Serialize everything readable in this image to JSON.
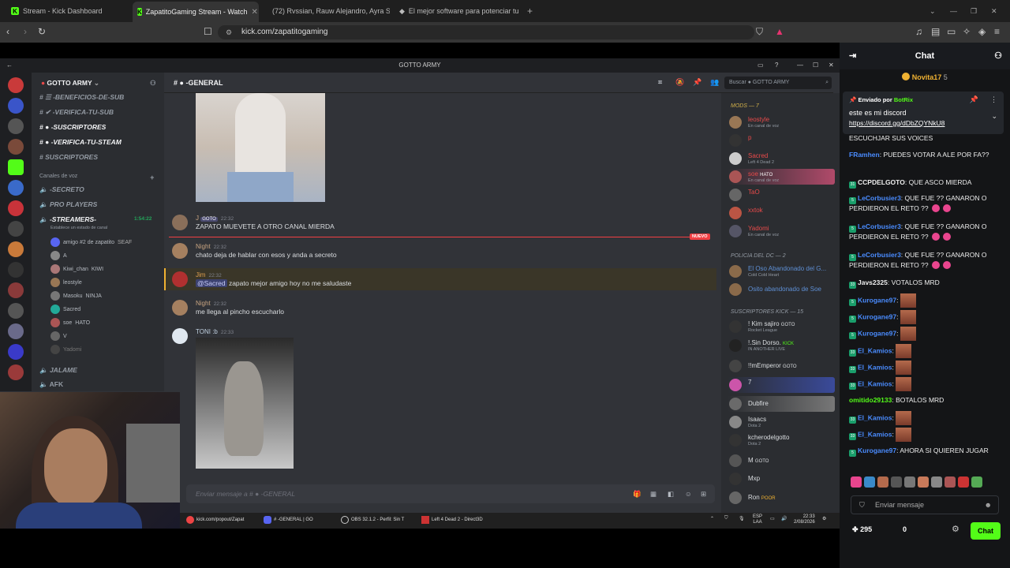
{
  "browser": {
    "tabs": [
      {
        "title": "Stream - Kick Dashboard"
      },
      {
        "title": "ZapatitoGaming Stream - Watch"
      },
      {
        "title": "(72) Rvssian, Rauw Alejandro, Ayra St"
      },
      {
        "title": "El mejor software para potenciar tu st"
      }
    ],
    "url": "kick.com/zapatitogaming"
  },
  "discord": {
    "window_title": "GOTTO ARMY",
    "server_name": "GOTTO ARMY",
    "current_channel": "-GENERAL",
    "search_placeholder": "Buscar",
    "search_scope": "GOTTO ARMY",
    "channels": [
      "-BENEFICIOS-DE-SUB",
      "-VERIFICA-TU-SUB",
      "-SUSCRIPTORES",
      "-VERIFICA-TU-STEAM",
      "SUSCRIPTORES"
    ],
    "voice_header": "Canales de voz",
    "voice_channels": [
      "-SECRETO",
      "PRO PLAYERS",
      "-STREAMERS-"
    ],
    "streamers_timer": "1:54:22",
    "streamers_status": "Establece un estado de canal",
    "voice_users": [
      "amigo #2 de zapatito",
      "A",
      "Kiwi_chan",
      "leostyle",
      "Masoku",
      "Sacred",
      "soe",
      "V",
      "Yadomi"
    ],
    "voice_user_tags": {
      "amigo": "SEAF",
      "kiwi": "KIWI",
      "masoku": "NINJA",
      "soe": "HATO"
    },
    "bottom_channels": [
      "JALAME",
      "AFK"
    ],
    "messages": [
      {
        "author": "J",
        "tag": "GOTO",
        "time": "22:32",
        "text": "ZAPATO MUEVETE A OTRO CANAL MIERDA"
      },
      {
        "author": "Night",
        "time": "22:32",
        "text": "chato deja de hablar con esos y anda a secreto"
      },
      {
        "author": "Jim",
        "time": "22:32",
        "mention": "@Sacred",
        "text": "zapato mejor amigo hoy no me saludaste"
      },
      {
        "author": "Night",
        "time": "22:32",
        "text": "me llega al pincho escucharlo"
      },
      {
        "author": "TONI :b",
        "time": "22:33",
        "text": ""
      }
    ],
    "new_badge": "NUEVO",
    "composer_placeholder": "Enviar mensaje a #",
    "composer_channel": "-GENERAL",
    "member_groups": [
      {
        "label": "MODS — 7",
        "members": [
          {
            "name": "leostyle",
            "status": "En canal de voz"
          },
          {
            "name": "p",
            "status": ""
          },
          {
            "name": "Sacred",
            "status": "Left 4 Dead 2"
          },
          {
            "name": "soe",
            "tag": "HATO",
            "status": "En canal de voz"
          },
          {
            "name": "TaO",
            "status": ""
          },
          {
            "name": "xxtok",
            "status": ""
          },
          {
            "name": "Yadomi",
            "status": "En canal de voz"
          }
        ]
      },
      {
        "label": "POLICIA DEL DC — 2",
        "members": [
          {
            "name": "El Oso Abandonado del G...",
            "status": "Cold Cold Heart"
          },
          {
            "name": "Osito abandonado de Soe",
            "status": ""
          }
        ]
      },
      {
        "label": "SUSCRIPTORES KICK — 15",
        "members": [
          {
            "name": "! Kim sajiro",
            "tag": "GOTO",
            "status": "Rocket League"
          },
          {
            "name": "!.Sin Dorso.",
            "tag": "KICK",
            "status": "IN ANOTHER LIVE"
          },
          {
            "name": "!!mEmperor",
            "tag": "GOTO",
            "status": ""
          },
          {
            "name": "7",
            "status": ""
          },
          {
            "name": "Dubfire",
            "status": ""
          },
          {
            "name": "Isaacs",
            "status": "Dota 2"
          },
          {
            "name": "kcherodelgotto",
            "status": "Dota 2"
          },
          {
            "name": "M",
            "tag": "GOTO",
            "status": ""
          },
          {
            "name": "Mxp",
            "status": ""
          },
          {
            "name": "Ron",
            "tag": "POOR",
            "status": ""
          }
        ]
      }
    ]
  },
  "taskbar": {
    "items": [
      "kick.com/popout/Zapat",
      "# -GENERAL | GO",
      "OBS 32.1.2 - Perfil: Sin T",
      "Left 4 Dead 2 - Direct3D"
    ],
    "lang": "ESP",
    "lang2": "LAA",
    "time": "22:33",
    "date": "2/08/2026"
  },
  "kick": {
    "title": "Chat",
    "top_user": "Novita17",
    "top_user_count": "5",
    "pinned_by_label": "Enviado por",
    "pinned_by": "BotRix",
    "pinned_text": "este es mi discord",
    "pinned_link": "https://discord.gg/dDbZQYNkU8",
    "messages": [
      {
        "user": "",
        "text": "ESCUCHJAR SUS VOICES"
      },
      {
        "user": "FRamhen",
        "text": "PUEDES VOTAR A ALE POR FA??"
      },
      {
        "user": "CCPDELGOTO",
        "text": "QUE ASCO MIERDA"
      },
      {
        "user": "LeCorbusier3",
        "text": "QUE FUE ?? GANARON O PERDIERON EL RETO ??"
      },
      {
        "user": "LeCorbusier3",
        "text": "QUE FUE ?? GANARON O PERDIERON EL RETO ??"
      },
      {
        "user": "LeCorbusier3",
        "text": "QUE FUE ?? GANARON O PERDIERON EL RETO ??"
      },
      {
        "user": "Javs2325",
        "text": "VOTALOS MRD"
      },
      {
        "user": "Kurogane97",
        "text": ""
      },
      {
        "user": "Kurogane97",
        "text": ""
      },
      {
        "user": "Kurogane97",
        "text": ""
      },
      {
        "user": "El_Kamios",
        "text": ""
      },
      {
        "user": "El_Kamios",
        "text": ""
      },
      {
        "user": "El_Kamios",
        "text": ""
      },
      {
        "user": "omitido29133",
        "text": "BOTALOS MRD"
      },
      {
        "user": "El_Kamios",
        "text": ""
      },
      {
        "user": "El_Kamios",
        "text": ""
      },
      {
        "user": "Kurogane97",
        "text": "AHORA SI QUIEREN JUGAR"
      }
    ],
    "input_placeholder": "Enviar mensaje",
    "viewer_count": "295",
    "points": "0",
    "chat_button": "Chat"
  },
  "colors": {
    "kick_green": "#53fc18",
    "discord_bg": "#313338",
    "mention": "#3c4270"
  }
}
